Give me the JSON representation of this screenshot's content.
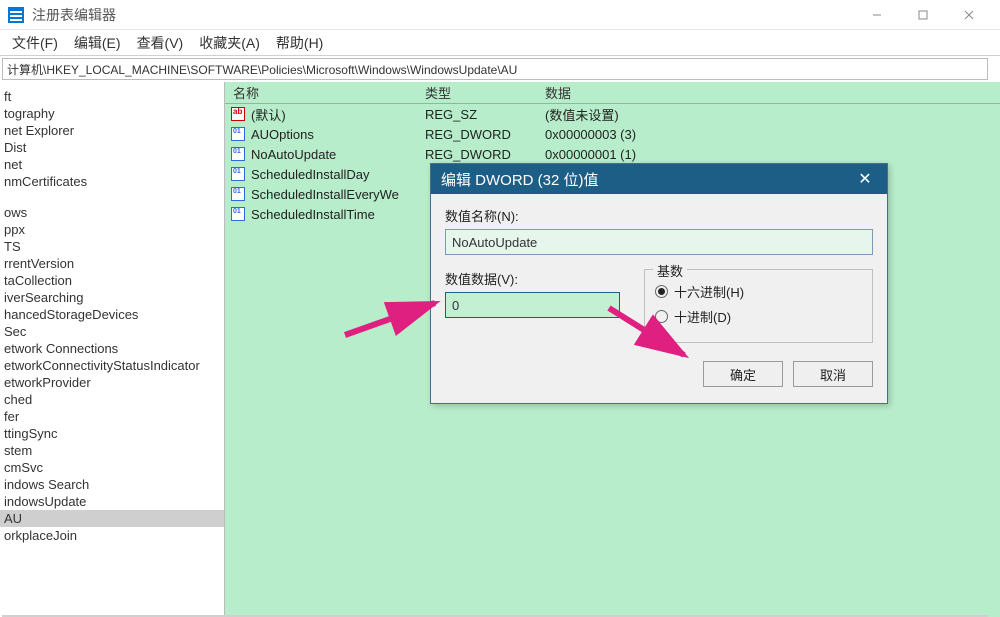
{
  "titlebar": {
    "title": "注册表编辑器"
  },
  "menu": {
    "file": "文件(F)",
    "edit": "编辑(E)",
    "view": "查看(V)",
    "fav": "收藏夹(A)",
    "help": "帮助(H)"
  },
  "address": {
    "path": "计算机\\HKEY_LOCAL_MACHINE\\SOFTWARE\\Policies\\Microsoft\\Windows\\WindowsUpdate\\AU"
  },
  "tree": {
    "items": [
      "ft",
      "tography",
      "net Explorer",
      "Dist",
      "net",
      "nmCertificates",
      "",
      "ows",
      "ppx",
      "TS",
      "rrentVersion",
      "taCollection",
      "iverSearching",
      "hancedStorageDevices",
      "Sec",
      "etwork Connections",
      "etworkConnectivityStatusIndicator",
      "etworkProvider",
      "ched",
      "fer",
      "ttingSync",
      "stem",
      "cmSvc",
      "indows Search",
      "indowsUpdate",
      "AU",
      "orkplaceJoin"
    ],
    "selected_index": 25
  },
  "columns": {
    "name": "名称",
    "type": "类型",
    "data": "数据"
  },
  "values": [
    {
      "icon": "sz",
      "name": "(默认)",
      "type": "REG_SZ",
      "data": "(数值未设置)"
    },
    {
      "icon": "dw",
      "name": "AUOptions",
      "type": "REG_DWORD",
      "data": "0x00000003 (3)"
    },
    {
      "icon": "dw",
      "name": "NoAutoUpdate",
      "type": "REG_DWORD",
      "data": "0x00000001 (1)"
    },
    {
      "icon": "dw",
      "name": "ScheduledInstallDay",
      "type": "",
      "data": ""
    },
    {
      "icon": "dw",
      "name": "ScheduledInstallEveryWe",
      "type": "",
      "data": ""
    },
    {
      "icon": "dw",
      "name": "ScheduledInstallTime",
      "type": "",
      "data": ""
    }
  ],
  "dialog": {
    "title": "编辑 DWORD (32 位)值",
    "name_label": "数值名称(N):",
    "name_value": "NoAutoUpdate",
    "data_label": "数值数据(V):",
    "data_value": "0",
    "base_label": "基数",
    "hex_label": "十六进制(H)",
    "dec_label": "十进制(D)",
    "ok": "确定",
    "cancel": "取消"
  }
}
